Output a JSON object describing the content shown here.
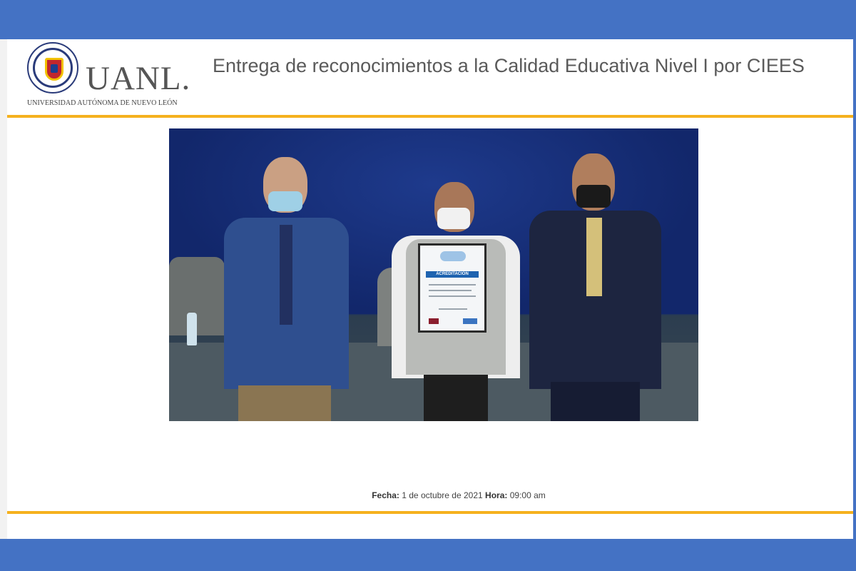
{
  "header": {
    "logo": {
      "wordmark": "UANL.",
      "subtitle": "UNIVERSIDAD AUTÓNOMA DE NUEVO LEÓN",
      "seal_text": "UNIVERSIDAD AUTÓNOMA DE NUEVO LEÓN"
    },
    "title": "Entrega de reconocimientos a la Calidad Educativa Nivel I por CIEES"
  },
  "photo": {
    "certificate_heading": "ACREDITACIÓN"
  },
  "footer": {
    "fecha_label": "Fecha:",
    "fecha_value": "1 de octubre de 2021",
    "hora_label": "Hora:",
    "hora_value": "09:00 am"
  },
  "colors": {
    "frame": "#4472c4",
    "rule": "#f5b11e",
    "title_text": "#5a5a5a"
  }
}
